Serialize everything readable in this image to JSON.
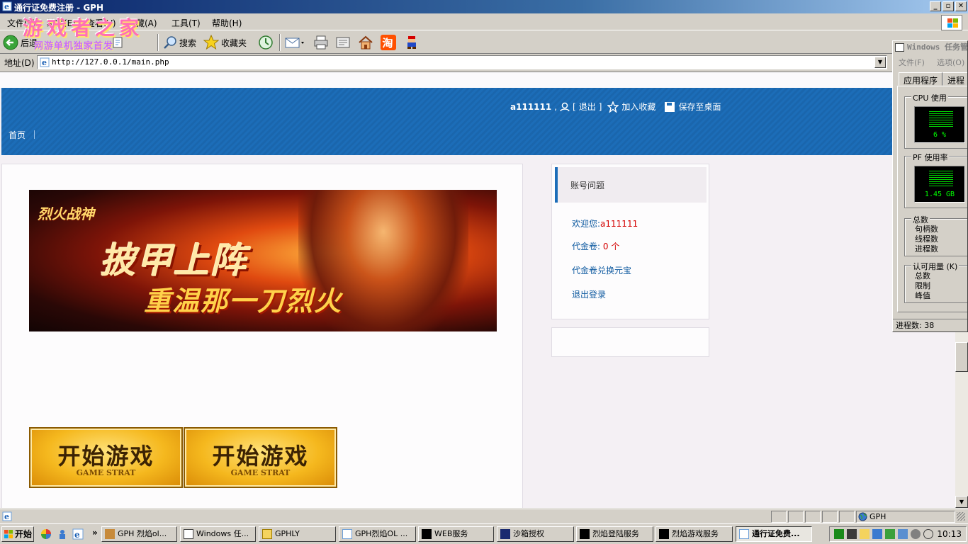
{
  "window": {
    "title": "通行证免费注册 - GPH",
    "min": "_",
    "max": "▫",
    "close": "✕"
  },
  "menu": [
    "文件(F)",
    "编辑(E)",
    "查看(V)",
    "收藏(A)",
    "工具(T)",
    "帮助(H)"
  ],
  "watermark": {
    "main": "游戏者之家",
    "sub": "网游单机独家首发"
  },
  "toolbar": {
    "back": "后退",
    "search": "搜索",
    "favorites": "收藏夹"
  },
  "address": {
    "label": "地址(D)",
    "url": "http://127.0.0.1/main.php"
  },
  "site": {
    "user": "a111111",
    "logout_bracket_open": "[",
    "logout": "退出",
    "logout_bracket_close": "]",
    "add_favorite": "加入收藏",
    "save_desktop": "保存至桌面",
    "nav_home": "首页",
    "banner": {
      "logo": "烈火战神",
      "line1": "披甲上阵",
      "line2": "重温那一刀烈火"
    },
    "start_buttons": [
      {
        "cn": "开始游戏",
        "en": "GAME STRAT"
      },
      {
        "cn": "开始游戏",
        "en": "GAME STRAT"
      }
    ],
    "side": {
      "heading": "账号问题",
      "welcome_label": "欢迎您:",
      "welcome_user": "a111111",
      "voucher_label": "代金卷:",
      "voucher_value": "0 个",
      "exchange": "代金卷兑换元宝",
      "logout": "退出登录"
    }
  },
  "taskmgr": {
    "title": "Windows 任务管理器",
    "menu": [
      "文件(F)",
      "选项(O)"
    ],
    "tabs": [
      "应用程序",
      "进程"
    ],
    "cpu_label": "CPU 使用",
    "cpu_value": "6 %",
    "pf_label": "PF 使用率",
    "pf_value": "1.45 GB",
    "totals_label": "总数",
    "totals": [
      "句柄数",
      "线程数",
      "进程数"
    ],
    "commit_label": "认可用量 (K)",
    "commit": [
      "总数",
      "限制",
      "峰值"
    ],
    "status": "进程数: 38"
  },
  "statusbar": {
    "zone": "GPH"
  },
  "taskbar": {
    "start": "开始",
    "more": "»",
    "tasks": [
      "GPH 烈焰ol...",
      "Windows 任...",
      "GPHLY",
      "GPH烈焰OL ...",
      "WEB服务",
      "沙箱授权",
      "烈焰登陆服务",
      "烈焰游戏服务",
      "通行证免费..."
    ],
    "clock": "10:13"
  },
  "colors": {
    "header_blue": "#1c6db8",
    "link_blue": "#0f5aa0",
    "red": "#d40000"
  }
}
